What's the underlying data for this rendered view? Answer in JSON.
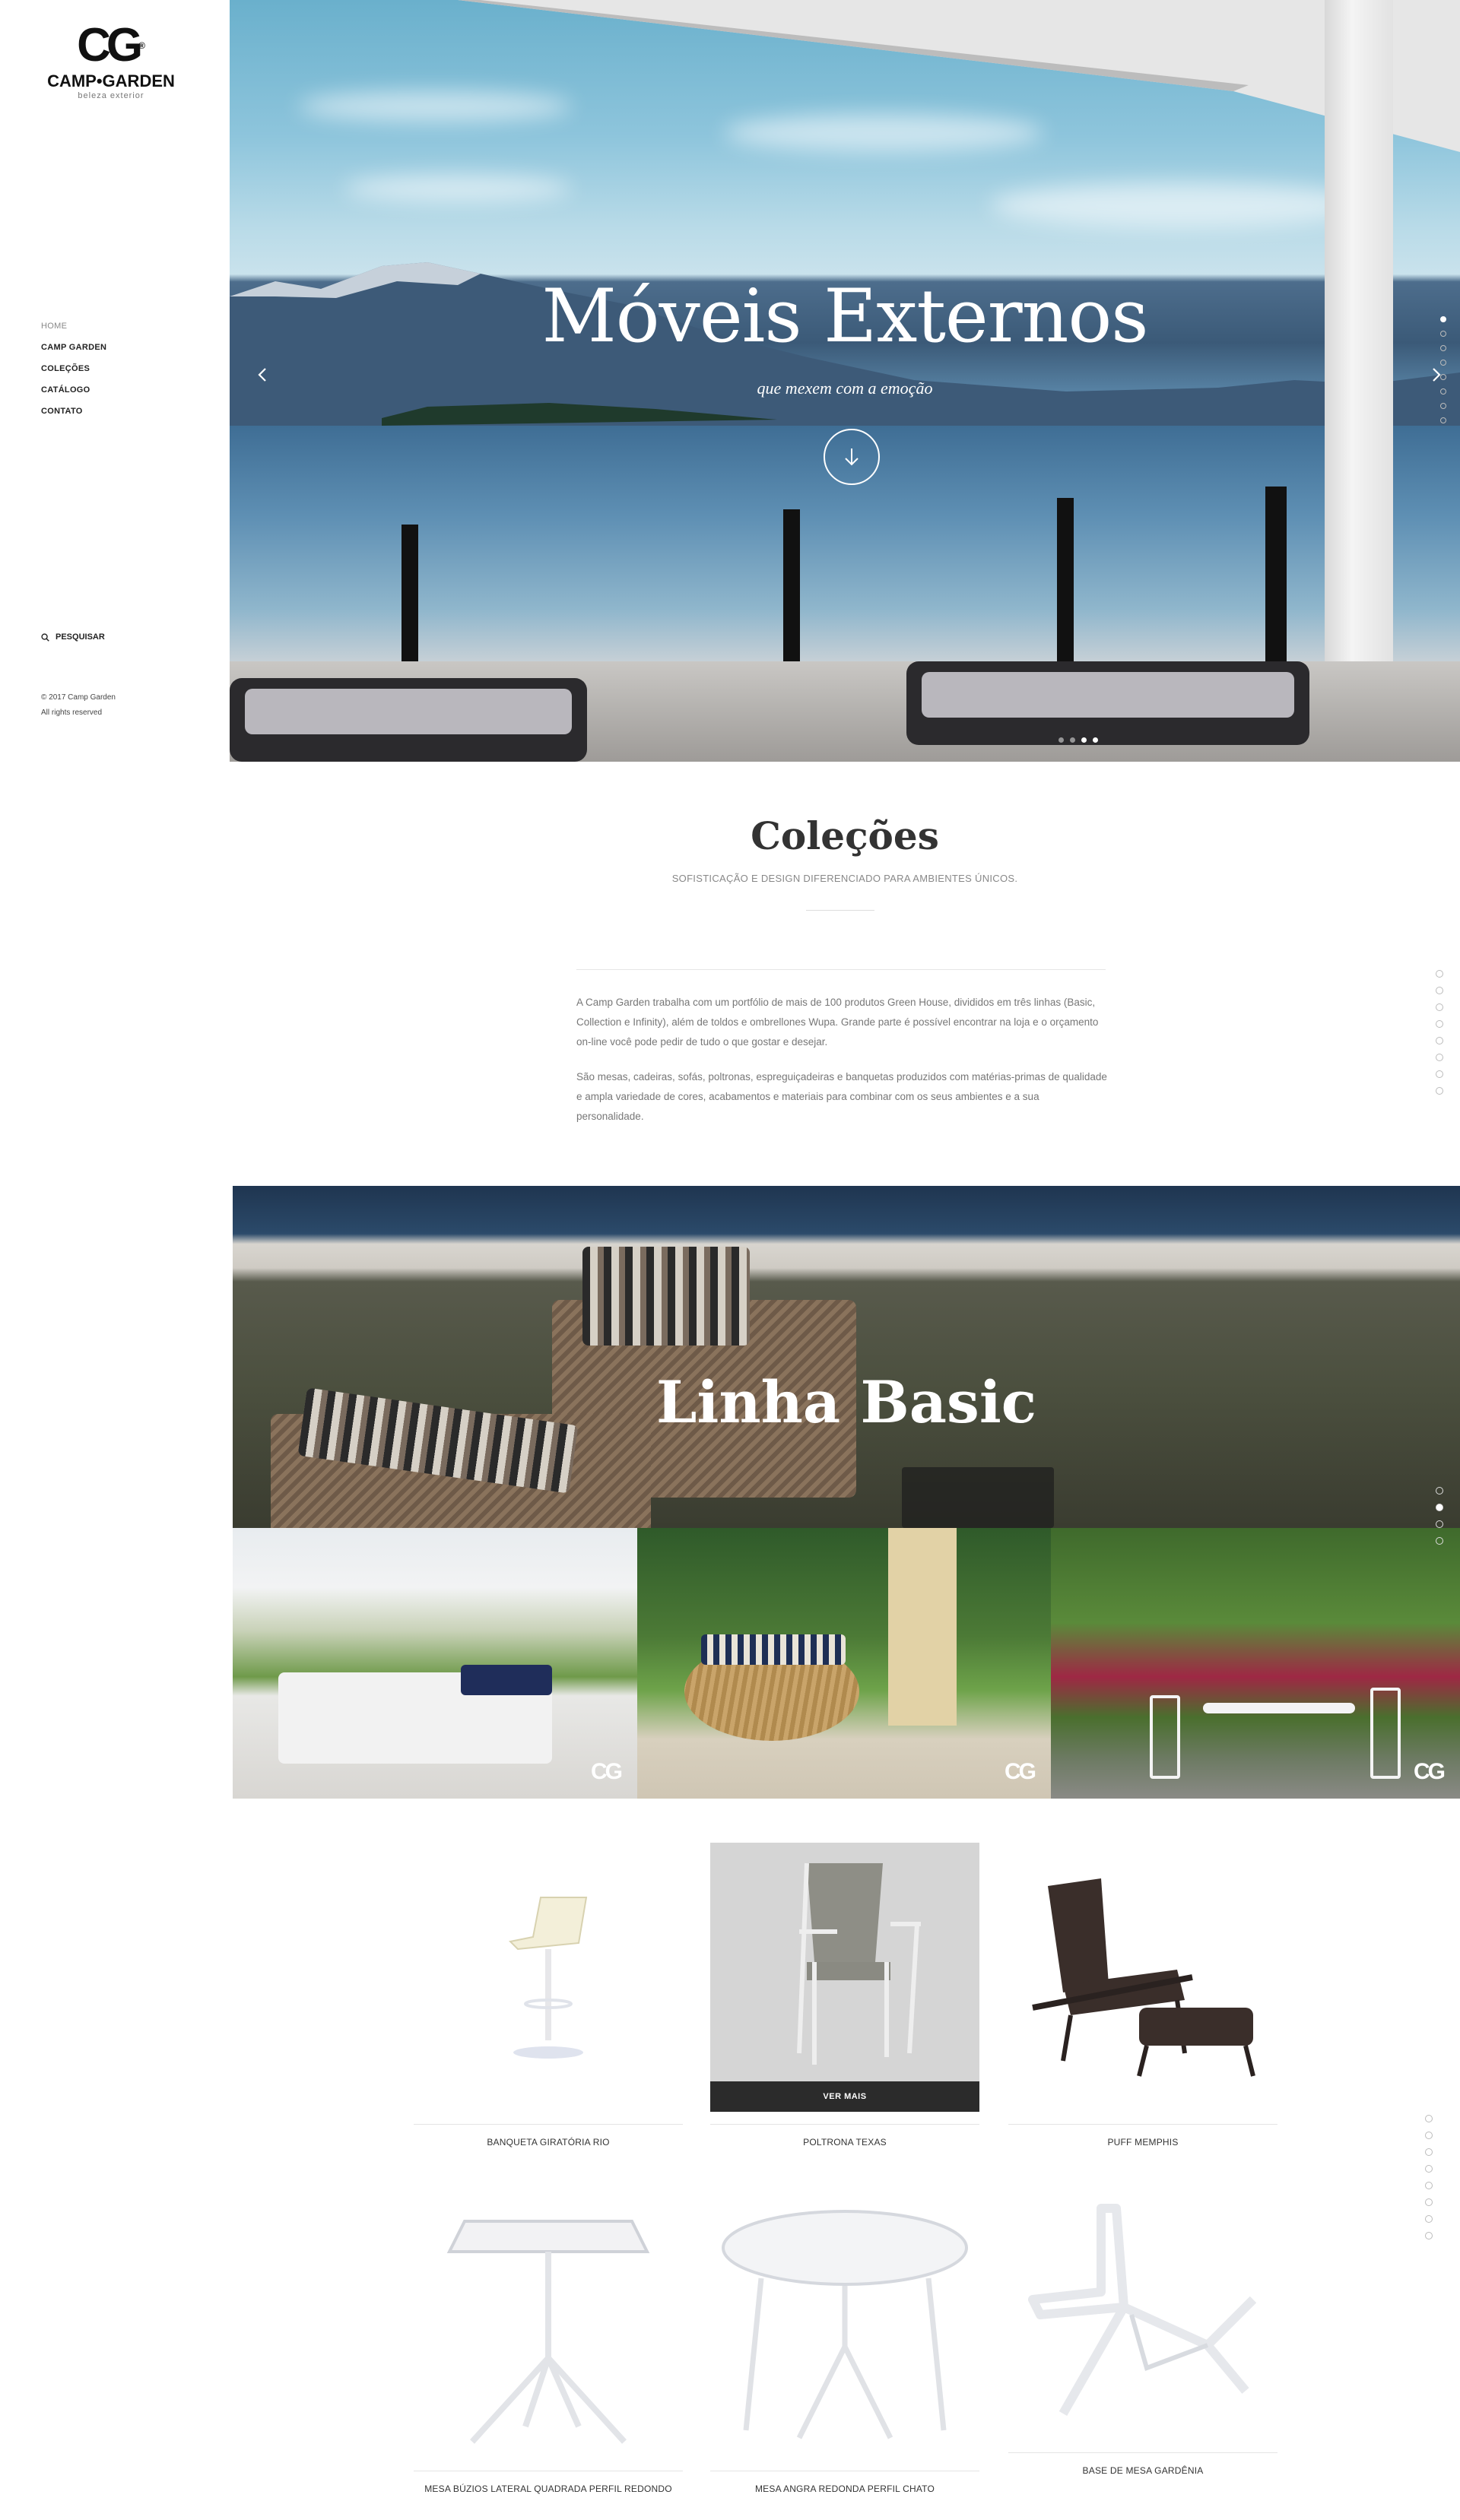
{
  "brand": {
    "mark": "CG",
    "registered": "®",
    "name": "CAMP•GARDEN",
    "tagline": "beleza exterior"
  },
  "nav": [
    {
      "label": "HOME",
      "active": true
    },
    {
      "label": "CAMP GARDEN",
      "active": false
    },
    {
      "label": "COLEÇÕES",
      "active": false
    },
    {
      "label": "CATÁLOGO",
      "active": false
    },
    {
      "label": "CONTATO",
      "active": false
    }
  ],
  "search": {
    "label": "PESQUISAR",
    "icon": "search-icon"
  },
  "footer": {
    "copyright": "© 2017 Camp Garden",
    "rights": "All rights reserved"
  },
  "hero": {
    "title": "Móveis Externos",
    "subtitle": "que mexem com a emoção",
    "prev_icon": "chevron-left-icon",
    "next_icon": "chevron-right-icon",
    "down_icon": "arrow-down-icon",
    "slides_total": 4,
    "active_slide": 3
  },
  "colecoes": {
    "title": "Coleções",
    "subtitle": "SOFISTICAÇÃO E DESIGN DIFERENCIADO PARA AMBIENTES ÚNICOS.",
    "paragraphs": [
      "A Camp Garden trabalha com um portfólio de mais de 100 produtos Green House, divididos em três linhas (Basic, Collection e Infinity), além de toldos e ombrellones Wupa. Grande parte é possível encontrar na loja e o orçamento on-line você pode pedir de tudo o que gostar e desejar.",
      "São mesas, cadeiras, sofás, poltronas, espreguiçadeiras e banquetas produzidos com matérias-primas de qualidade e ampla variedade de cores, acabamentos e materiais para combinar com os seus ambientes e a sua personalidade."
    ]
  },
  "linha_basic": {
    "title": "Linha Basic"
  },
  "photo_badge": "CG",
  "products": {
    "ver_mais": "VER MAIS",
    "items": [
      {
        "name": "BANQUETA GIRATÓRIA RIO"
      },
      {
        "name": "POLTRONA TEXAS"
      },
      {
        "name": "PUFF MEMPHIS"
      },
      {
        "name": "MESA BÚZIOS LATERAL QUADRADA PERFIL REDONDO"
      },
      {
        "name": "MESA ANGRA REDONDA PERFIL CHATO"
      },
      {
        "name": "BASE DE MESA GARDÊNIA"
      }
    ]
  },
  "colors": {
    "accent": "#222222",
    "muted": "#888888",
    "ver_mais_bg": "#2b2b2b"
  }
}
